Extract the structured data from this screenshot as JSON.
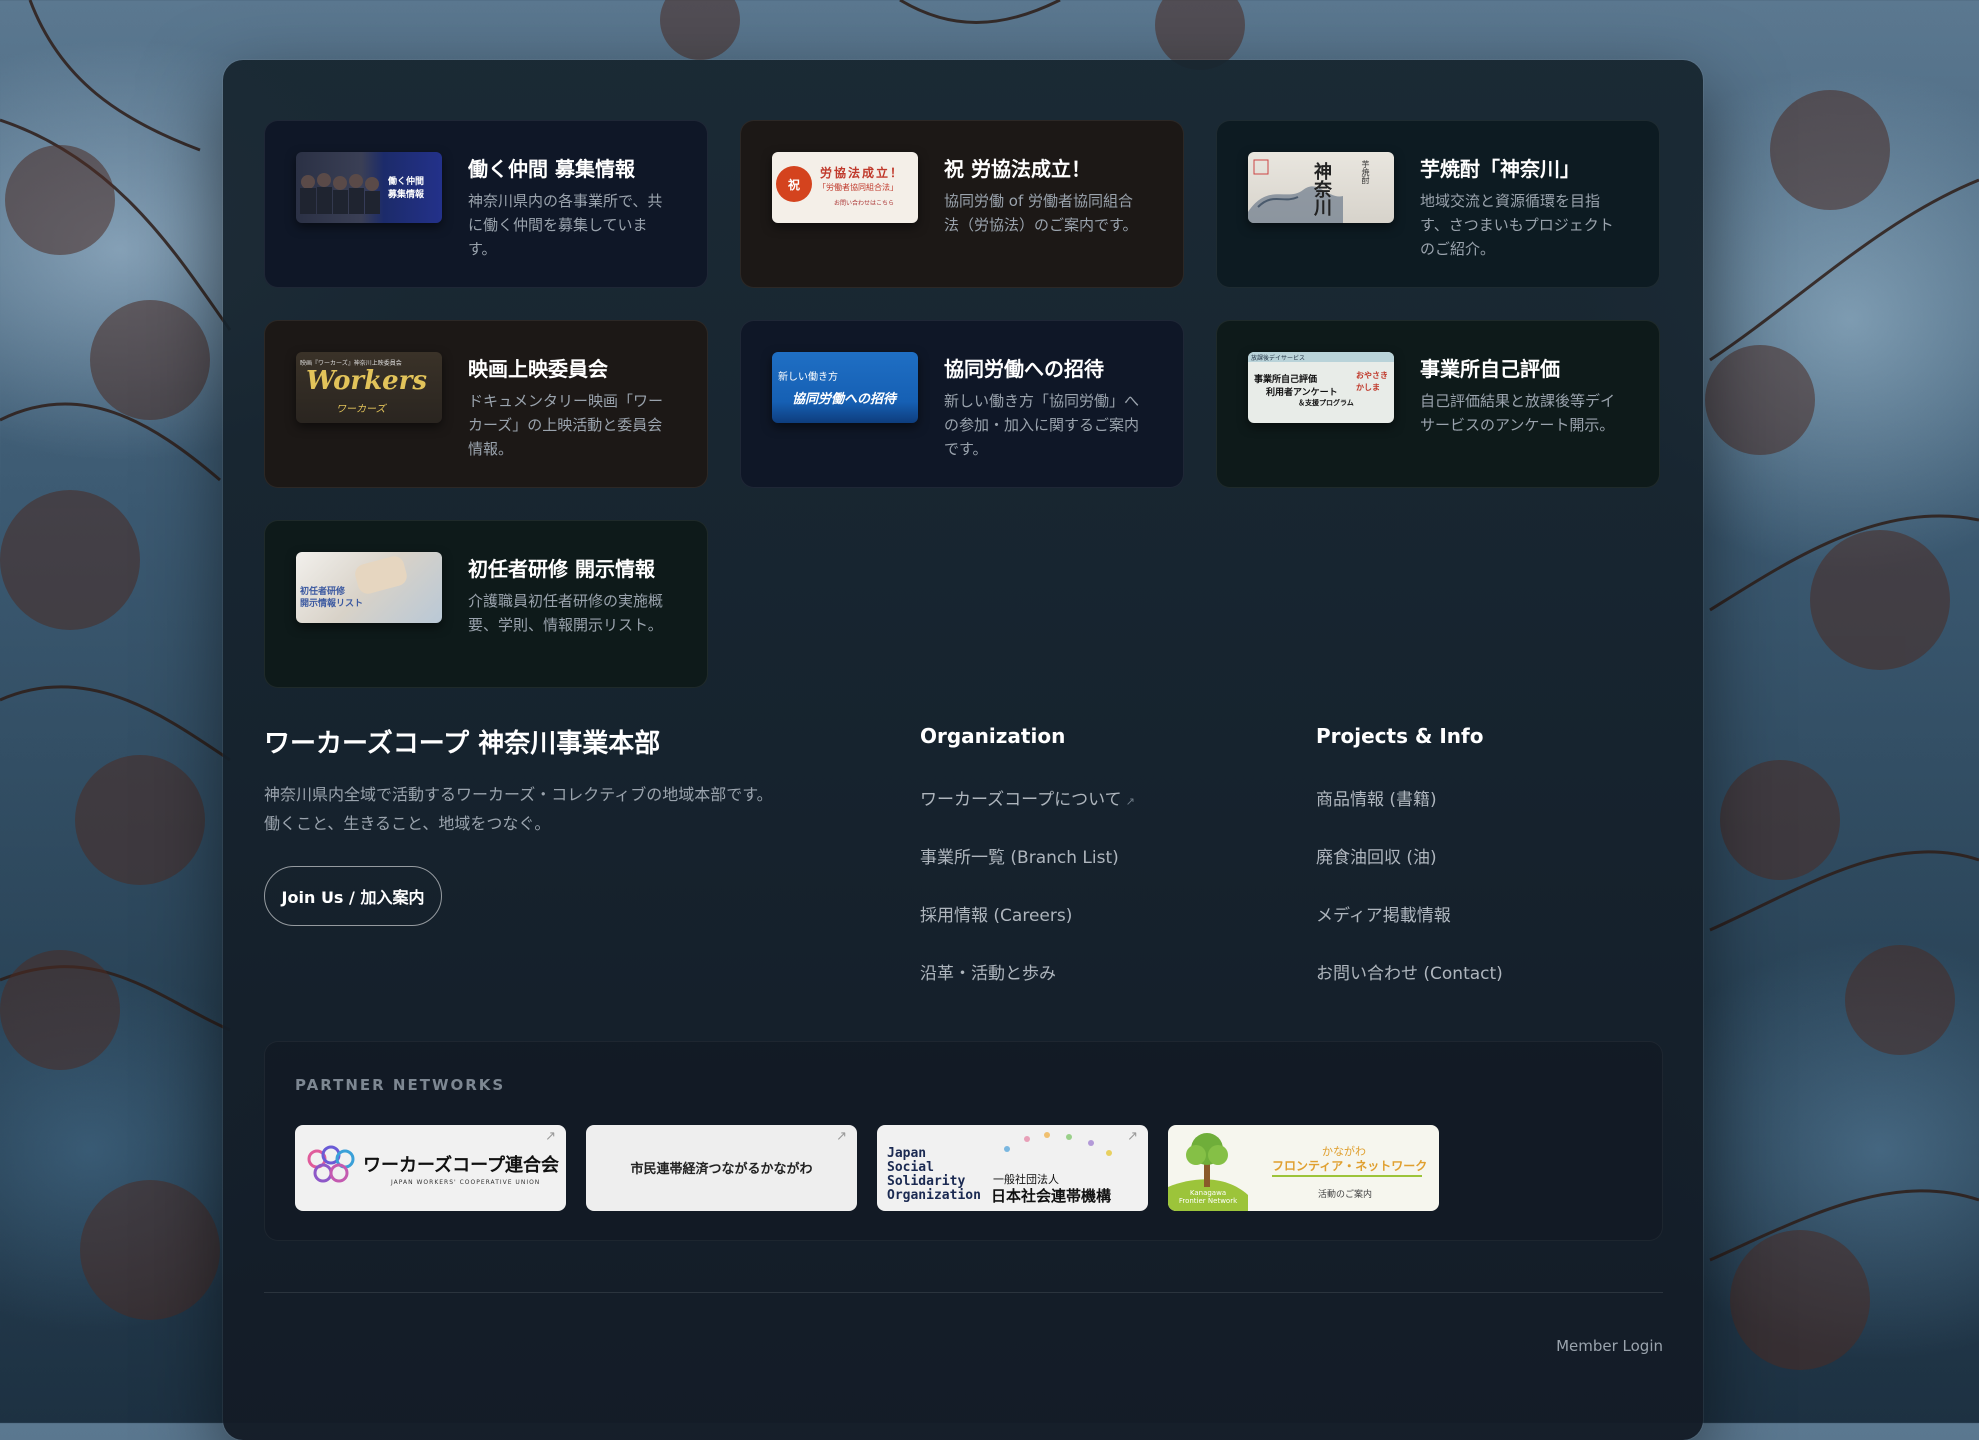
{
  "cards": [
    {
      "title": "働く仲間 募集情報",
      "desc": [
        "神奈川県内の各事業所で、共",
        "に働く仲間を募集していま",
        "す。"
      ],
      "thumb": "働く仲間 募集情報"
    },
    {
      "title": "祝 労協法成立！",
      "desc": [
        "協同労働 of 労働者協同組合",
        "法（労協法）のご案内です。"
      ],
      "thumb": "労協法成立！ 労働者協同組合法"
    },
    {
      "title": "芋焼酎「神奈川」",
      "desc": [
        "地域交流と資源循環を目指",
        "す、さつまいもプロジェクト",
        "のご紹介。"
      ],
      "thumb": "神奈川"
    },
    {
      "title": "映画上映委員会",
      "desc": [
        "ドキュメンタリー映画「ワー",
        "カーズ」の上映活動と委員会",
        "情報。"
      ],
      "thumb": "Workers"
    },
    {
      "title": "協同労働への招待",
      "desc": [
        "新しい働き方「協同労働」へ",
        "の参加・加入に関するご案内",
        "です。"
      ],
      "thumb": "協同労働への招待"
    },
    {
      "title": "事業所自己評価",
      "desc": [
        "自己評価結果と放課後等デイ",
        "サービスのアンケート開示。"
      ],
      "thumb": "事業所自己評価 利用者アンケート"
    },
    {
      "title": "初任者研修 開示情報",
      "desc": [
        "介護職員初任者研修の実施概",
        "要、学則、情報開示リスト。"
      ],
      "thumb": "初任者研修 開示情報リスト"
    }
  ],
  "footer": {
    "brand": "ワーカーズコープ 神奈川事業本部",
    "desc": [
      "神奈川県内全域で活動するワーカーズ・コレクティブの地域本部です。",
      "働くこと、生きること、地域をつなぐ。"
    ],
    "join": "Join Us / 加入案内",
    "org_title": "Organization",
    "org_links": [
      "ワーカーズコープについて",
      "事業所一覧 (Branch List)",
      "採用情報 (Careers)",
      "沿革・活動と歩み"
    ],
    "proj_title": "Projects & Info",
    "proj_links": [
      "商品情報 (書籍)",
      "廃食油回収 (油)",
      "メディア掲載情報",
      "お問い合わせ (Contact)"
    ],
    "partners_title": "PARTNER NETWORKS",
    "partners": [
      "ワーカーズコープ連合会",
      "市民連帯経済つながるかながわ",
      "一般社団法人 日本社会連帯機構",
      "かながわ フロンティア・ネットワーク"
    ],
    "member_login": "Member Login"
  },
  "thumb_text": {
    "t1a": "働く仲間",
    "t1b": "募集情報",
    "t2a": "祝",
    "t2b": "労協法成立！",
    "t2c": "「労働者協同組合法」",
    "t2d": "お問い合わせはこちら",
    "t3a": "神奈川",
    "t3b": "芋焼酎",
    "t4a": "映画『ワーカーズ』神奈川上映委員会",
    "t4b": "Workers",
    "t4c": "ワーカーズ",
    "t5a": "新しい働き方",
    "t5b": "協同労働への招待",
    "t6a": "放課後デイサービス",
    "t6b": "事業所自己評価",
    "t6c": "利用者アンケート",
    "t6d": "＆支援プログラム",
    "t6e": "おやさき",
    "t6f": "かしま",
    "t7a": "初任者研修",
    "t7b": "開示情報リスト"
  },
  "partner_text": {
    "p1a": "ワーカーズコープ連合会",
    "p1b": "JAPAN WORKERS' COOPERATIVE UNION",
    "p2a": "市民連帯経済つながるかながわ",
    "p3a": "Japan",
    "p3b": "Social",
    "p3c": "Solidarity",
    "p3d": "Organization",
    "p3e": "一般社団法人",
    "p3f": "日本社会連帯機構",
    "p4a": "かながわ",
    "p4b": "フロンティア・ネットワーク",
    "p4c": "活動のご案内",
    "p4d": "Kanagawa",
    "p4e": "Frontier Network"
  },
  "colors": {
    "accent": "#ffffff",
    "muted": "#9aa3ad",
    "card_navy": "#0f1727",
    "card_brown": "#1c1816",
    "card_teal": "#0d1b22"
  }
}
